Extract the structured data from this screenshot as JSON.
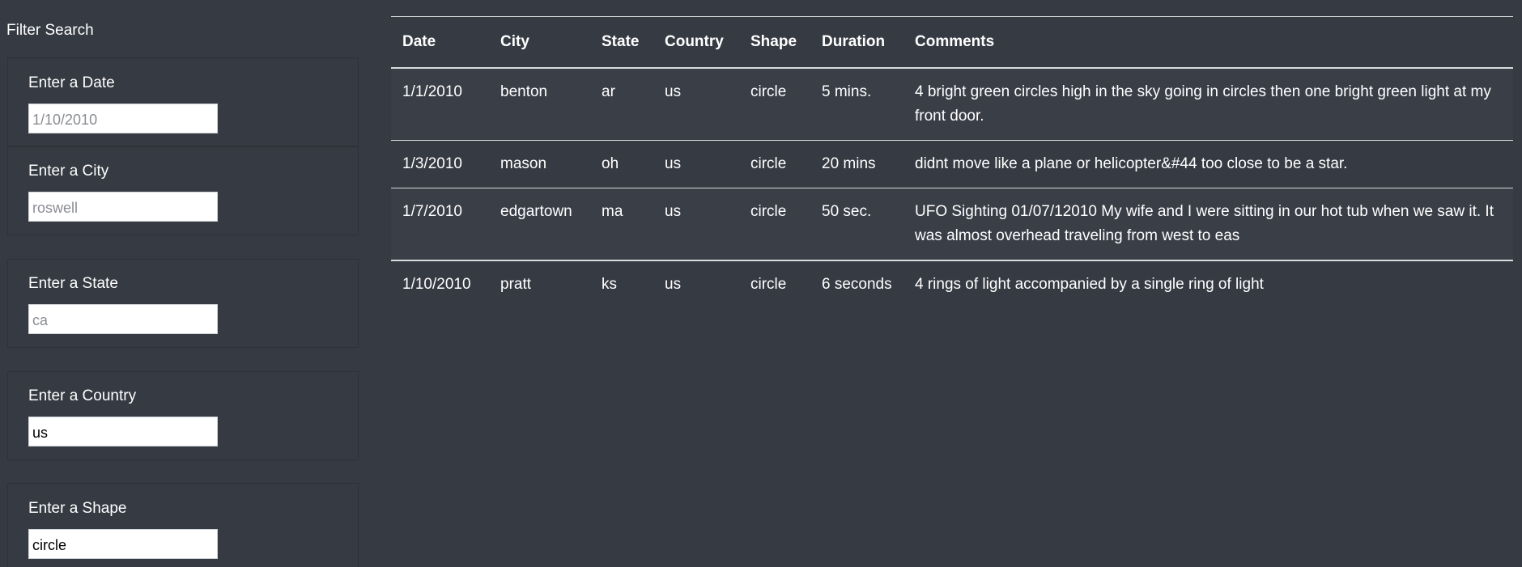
{
  "sidebar": {
    "title": "Filter Search",
    "filters": [
      {
        "label": "Enter a Date",
        "placeholder": "1/10/2010",
        "value": ""
      },
      {
        "label": "Enter a City",
        "placeholder": "roswell",
        "value": ""
      },
      {
        "label": "Enter a State",
        "placeholder": "ca",
        "value": ""
      },
      {
        "label": "Enter a Country",
        "placeholder": "",
        "value": "us"
      },
      {
        "label": "Enter a Shape",
        "placeholder": "",
        "value": "circle"
      }
    ]
  },
  "table": {
    "headers": [
      "Date",
      "City",
      "State",
      "Country",
      "Shape",
      "Duration",
      "Comments"
    ],
    "rows": [
      [
        "1/1/2010",
        "benton",
        "ar",
        "us",
        "circle",
        "5 mins.",
        "4 bright green circles high in the sky going in circles then one bright green light at my front door."
      ],
      [
        "1/3/2010",
        "mason",
        "oh",
        "us",
        "circle",
        "20 mins",
        "didnt move like a plane or helicopter&#44 too close to be a star."
      ],
      [
        "1/7/2010",
        "edgartown",
        "ma",
        "us",
        "circle",
        "50 sec.",
        "UFO Sighting 01/07/12010 My wife and I were sitting in our hot tub when we saw it. It was almost overhead traveling from west to eas"
      ],
      [
        "1/10/2010",
        "pratt",
        "ks",
        "us",
        "circle",
        "6 seconds",
        "4 rings of light accompanied by a single ring of light"
      ]
    ]
  },
  "colors": {
    "background": "#363a42",
    "stripe": "#3a3e47",
    "rule": "#d8dadd"
  }
}
